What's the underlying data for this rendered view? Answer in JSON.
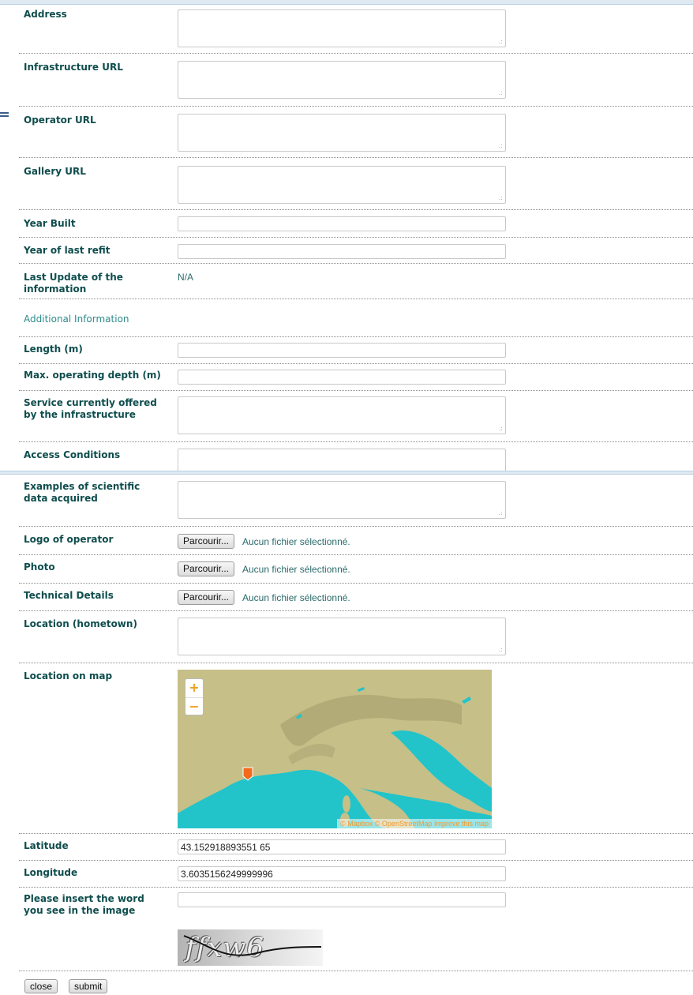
{
  "fields": {
    "address": "Address",
    "infrastructure_url": "Infrastructure URL",
    "operator_url": "Operator URL",
    "gallery_url": "Gallery URL",
    "year_built": "Year Built",
    "year_refit": "Year of last refit",
    "last_update_label": "Last Update of the information",
    "last_update_value": "N/A",
    "additional_info": "Additional Information",
    "length": "Length (m)",
    "max_depth": "Max. operating depth (m)",
    "service": "Service currently offered by the infrastructure",
    "access": "Access Conditions",
    "examples": "Examples of scientific data acquired",
    "logo": "Logo of operator",
    "photo": "Photo",
    "technical": "Technical Details",
    "location_hometown": "Location (hometown)",
    "location_map": "Location on map",
    "latitude": "Latitude",
    "latitude_value": "43.152918893551 65",
    "longitude": "Longitude",
    "longitude_value": "3.6035156249999996",
    "captcha_prompt": "Please insert the word you see in the image"
  },
  "file_input": {
    "button_label": "Parcourir...",
    "status": "Aucun fichier sélectionné."
  },
  "map": {
    "zoom_in": "+",
    "zoom_out": "−",
    "attribution": "© Mapbox © OpenStreetMap Improve this map"
  },
  "captcha": {
    "text": "ffxw6"
  },
  "buttons": {
    "close": "close",
    "submit": "submit"
  },
  "colors": {
    "label": "#0f4d4d",
    "accent": "#2e8b8b",
    "sea": "#1fc3c9",
    "land": "#c7c08a",
    "marker": "#f26a1b"
  }
}
